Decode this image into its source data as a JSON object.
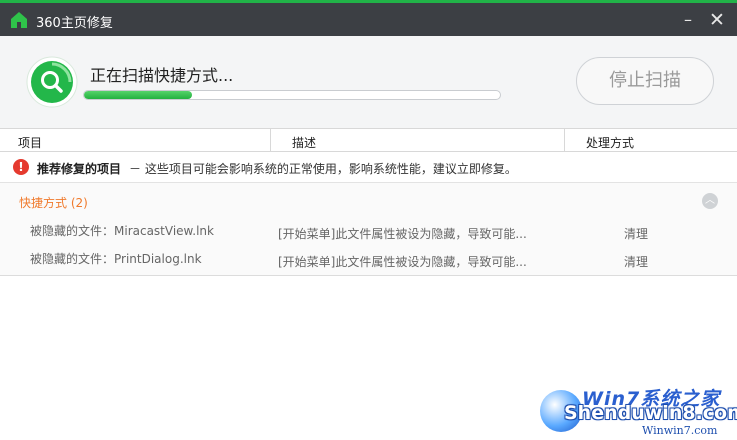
{
  "window": {
    "title": "360主页修复",
    "minimize_glyph": "–",
    "close_glyph": "✕"
  },
  "colors": {
    "accent_green": "#21b348",
    "titlebar": "#3c3f44",
    "warning_red": "#e53a2f",
    "group_orange": "#f07a2c"
  },
  "scan": {
    "status": "正在扫描快捷方式...",
    "progress_percent": 26,
    "stop_label": "停止扫描",
    "icon": "search-icon"
  },
  "columns": {
    "item": "项目",
    "desc": "描述",
    "action": "处理方式"
  },
  "recommend": {
    "icon": "warning-icon",
    "glyph": "!",
    "title": "推荐修复的项目",
    "desc": "－ 这些项目可能会影响系统的正常使用，影响系统性能，建议立即修复。"
  },
  "group": {
    "title": "快捷方式 (2)",
    "collapse_glyph": "︿"
  },
  "items": [
    {
      "name": "被隐藏的文件：MiracastView.lnk",
      "desc": "[开始菜单]此文件属性被设为隐藏，导致可能...",
      "action": "清理"
    },
    {
      "name": "被隐藏的文件：PrintDialog.lnk",
      "desc": "[开始菜单]此文件属性被设为隐藏，导致可能...",
      "action": "清理"
    }
  ],
  "watermark": {
    "top": "Win7系统之家",
    "main": "Shenduwin8.com",
    "sub": "Winwin7.com"
  }
}
